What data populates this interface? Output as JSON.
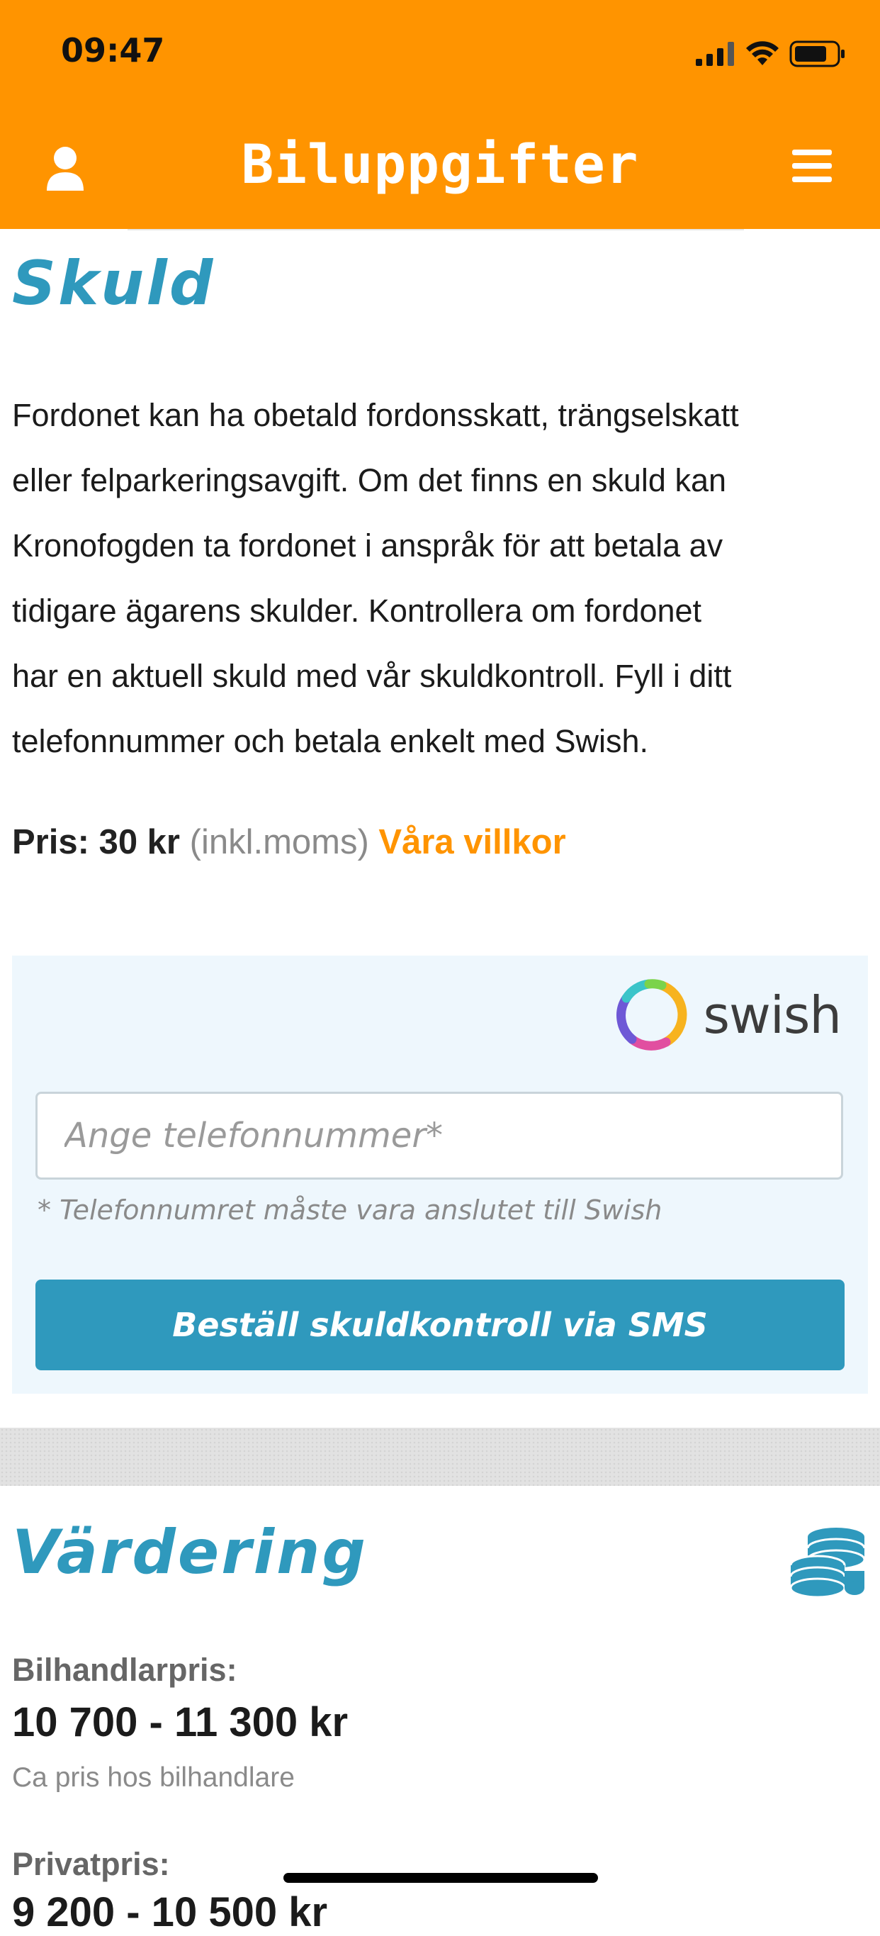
{
  "status_bar": {
    "time": "09:47",
    "color": "#ff9400"
  },
  "header": {
    "title": "Biluppgifter",
    "user_icon": "user-icon",
    "menu_icon": "hamburger-menu-icon"
  },
  "skuld": {
    "title": "Skuld",
    "lines": [
      "Fordonet kan ha obetald fordonsskatt, trängselskatt",
      "eller felparkeringsavgift. Om det finns en skuld kan",
      "Kronofogden ta fordonet i anspråk för att betala av",
      "tidigare ägarens skulder. Kontrollera om fordonet",
      "har en aktuell skuld med vår skuldkontroll. Fyll i ditt",
      "telefonnummer och betala enkelt med Swish."
    ],
    "price_label": "Pris:",
    "price_value": "30 kr",
    "price_note": "(inkl.moms)",
    "terms_link": "Våra villkor"
  },
  "swish": {
    "logo_text": "swish",
    "phone_placeholder": "Ange telefonnummer*",
    "phone_note": "* Telefonnumret måste vara anslutet till Swish",
    "order_button": "Beställ skuldkontroll via SMS"
  },
  "vardering": {
    "title": "Värdering",
    "icon": "coins-stack-icon",
    "dealer_label": "Bilhandlarpris:",
    "dealer_value": "10 700 - 11 300 kr",
    "dealer_hint": "Ca pris hos bilhandlare",
    "private_label": "Privatpris:",
    "private_value": "9 200 - 10 500 kr"
  },
  "colors": {
    "accent": "#ff9400",
    "heading": "#2f99bd",
    "panel": "#eef7fd"
  }
}
